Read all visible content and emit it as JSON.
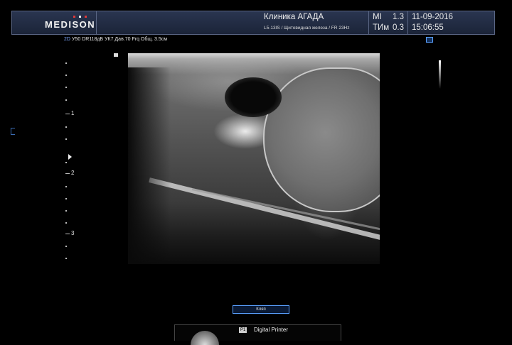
{
  "header": {
    "logo": "MEDISON",
    "logo_dot_colors": [
      "#e03a3a",
      "#f0f0f0",
      "#e03a3a"
    ],
    "clinic_name": "Клиника АГАДА",
    "probe_info": "L5-13IS / Щитовидная железа / FR 23Hz",
    "mi_label": "MI",
    "mi_value": "1.3",
    "ti_label": "TИм",
    "ti_value": "0.3",
    "date": "11-09-2016",
    "time": "15:06:55"
  },
  "params": {
    "mode": "2D",
    "text": "У50 DR118дБ УК7 Дав.70 Frq Общ. 3.5см"
  },
  "depth_scale": {
    "labels": [
      "1",
      "2",
      "3"
    ]
  },
  "controls": {
    "button_label": "Кляп",
    "printer_badge": "P1",
    "printer_label": "Digital Printer"
  },
  "colors": {
    "header_bg": "#1b2438",
    "accent_blue": "#5aa0ff"
  }
}
